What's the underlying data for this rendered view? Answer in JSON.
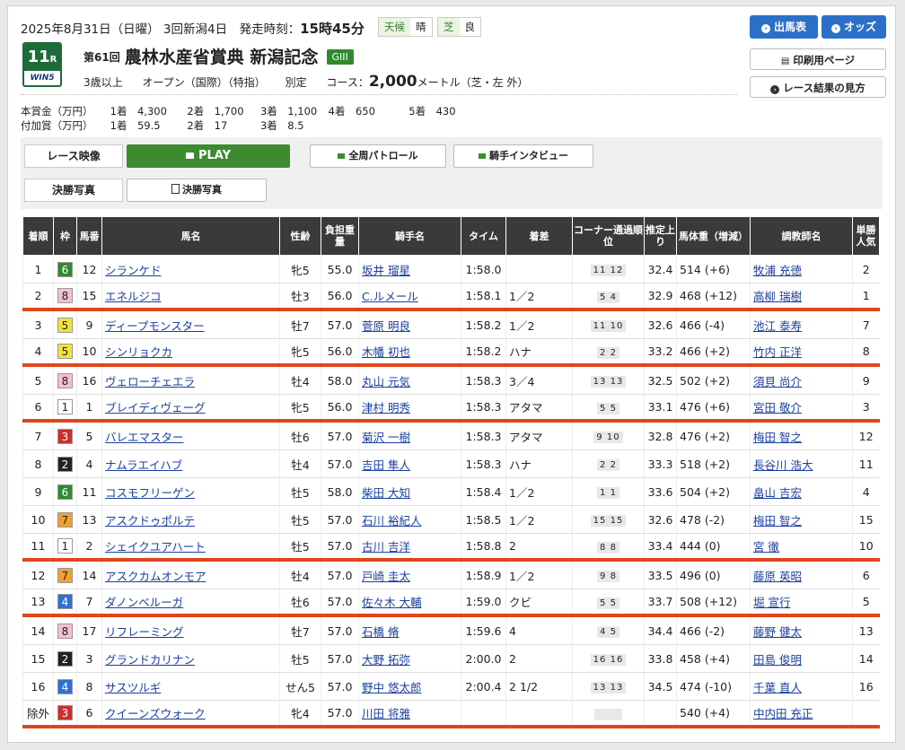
{
  "header": {
    "date_line": "2025年8月31日（日曜） 3回新潟4日　発走時刻：",
    "post_time": "15時45分",
    "weather_key": "天候",
    "weather_val": "晴",
    "turf_key": "芝",
    "turf_val": "良",
    "race_num": "11",
    "race_num_suffix": "R",
    "win5_label": "WIN5",
    "ordinal": "第61回",
    "race_name": "農林水産省賞典 新潟記念",
    "grade": "GIII",
    "age": "3歳以上",
    "class": "オープン（国際）（特指）",
    "weight_rule": "別定",
    "course_label": "コース：",
    "distance": "2,000",
    "course_detail": "メートル（芝・左 外）"
  },
  "prize_main": {
    "label": "本賞金（万円）",
    "items": [
      "1着　4,300",
      "2着　1,700",
      "3着　1,100",
      "4着　650",
      "5着　430"
    ]
  },
  "prize_add": {
    "label": "付加賞（万円）",
    "items": [
      "1着　59.5",
      "2着　17",
      "3着　8.5"
    ]
  },
  "buttons": {
    "card": "出馬表",
    "odds": "オッズ",
    "print": "印刷用ページ",
    "howto": "レース結果の見方"
  },
  "video": {
    "label": "レース映像",
    "play": "PLAY",
    "patrol": "全周パトロール",
    "interview": "騎手インタビュー"
  },
  "photo": {
    "label": "決勝写真",
    "button": "決勝写真"
  },
  "table_headers": [
    "着順",
    "枠",
    "馬番",
    "馬名",
    "性齢",
    "負担重量",
    "騎手名",
    "タイム",
    "着差",
    "コーナー通過順位",
    "推定上り",
    "馬体重（増減）",
    "調教師名",
    "単勝人気"
  ],
  "colors": {
    "accent_red": "#e0451b",
    "play_green": "#3d8b2e",
    "button_blue": "#2c6fc9"
  },
  "rows": [
    {
      "pos": "1",
      "waku": "6",
      "num": "12",
      "name": "シランケド",
      "sex": "牝5",
      "wt": "55.0",
      "jockey": "坂井 瑠星",
      "time": "1:58.0",
      "margin": "",
      "corner": "11 12",
      "last": "32.4",
      "body": "514 (+6)",
      "trainer": "牧浦 充徳",
      "pop": "2",
      "hl": false
    },
    {
      "pos": "2",
      "waku": "8",
      "num": "15",
      "name": "エネルジコ",
      "sex": "牡3",
      "wt": "56.0",
      "jockey": "C.ルメール",
      "time": "1:58.1",
      "margin": "1／2",
      "corner": "5 4",
      "last": "32.9",
      "body": "468 (+12)",
      "trainer": "高柳 瑞樹",
      "pop": "1",
      "hl": true
    },
    {
      "pos": "3",
      "waku": "5",
      "num": "9",
      "name": "ディープモンスター",
      "sex": "牡7",
      "wt": "57.0",
      "jockey": "菅原 明良",
      "time": "1:58.2",
      "margin": "1／2",
      "corner": "11 10",
      "last": "32.6",
      "body": "466 (-4)",
      "trainer": "池江 泰寿",
      "pop": "7",
      "hl": false
    },
    {
      "pos": "4",
      "waku": "5",
      "num": "10",
      "name": "シンリョクカ",
      "sex": "牝5",
      "wt": "56.0",
      "jockey": "木幡 初也",
      "time": "1:58.2",
      "margin": "ハナ",
      "corner": "2 2",
      "last": "33.2",
      "body": "466 (+2)",
      "trainer": "竹内 正洋",
      "pop": "8",
      "hl": true
    },
    {
      "pos": "5",
      "waku": "8",
      "num": "16",
      "name": "ヴェローチェエラ",
      "sex": "牡4",
      "wt": "58.0",
      "jockey": "丸山 元気",
      "time": "1:58.3",
      "margin": "3／4",
      "corner": "13 13",
      "last": "32.5",
      "body": "502 (+2)",
      "trainer": "須貝 尚介",
      "pop": "9",
      "hl": false
    },
    {
      "pos": "6",
      "waku": "1",
      "num": "1",
      "name": "ブレイディヴェーグ",
      "sex": "牝5",
      "wt": "56.0",
      "jockey": "津村 明秀",
      "time": "1:58.3",
      "margin": "アタマ",
      "corner": "5 5",
      "last": "33.1",
      "body": "476 (+6)",
      "trainer": "宮田 敬介",
      "pop": "3",
      "hl": true
    },
    {
      "pos": "7",
      "waku": "3",
      "num": "5",
      "name": "バレエマスター",
      "sex": "牡6",
      "wt": "57.0",
      "jockey": "菊沢 一樹",
      "time": "1:58.3",
      "margin": "アタマ",
      "corner": "9 10",
      "last": "32.8",
      "body": "476 (+2)",
      "trainer": "梅田 智之",
      "pop": "12",
      "hl": false
    },
    {
      "pos": "8",
      "waku": "2",
      "num": "4",
      "name": "ナムラエイハブ",
      "sex": "牡4",
      "wt": "57.0",
      "jockey": "吉田 隼人",
      "time": "1:58.3",
      "margin": "ハナ",
      "corner": "2 2",
      "last": "33.3",
      "body": "518 (+2)",
      "trainer": "長谷川 浩大",
      "pop": "11",
      "hl": false
    },
    {
      "pos": "9",
      "waku": "6",
      "num": "11",
      "name": "コスモフリーゲン",
      "sex": "牡5",
      "wt": "58.0",
      "jockey": "柴田 大知",
      "time": "1:58.4",
      "margin": "1／2",
      "corner": "1 1",
      "last": "33.6",
      "body": "504 (+2)",
      "trainer": "畠山 吉宏",
      "pop": "4",
      "hl": false
    },
    {
      "pos": "10",
      "waku": "7",
      "num": "13",
      "name": "アスクドゥポルテ",
      "sex": "牡5",
      "wt": "57.0",
      "jockey": "石川 裕紀人",
      "time": "1:58.5",
      "margin": "1／2",
      "corner": "15 15",
      "last": "32.6",
      "body": "478 (-2)",
      "trainer": "梅田 智之",
      "pop": "15",
      "hl": false
    },
    {
      "pos": "11",
      "waku": "1",
      "num": "2",
      "name": "シェイクユアハート",
      "sex": "牡5",
      "wt": "57.0",
      "jockey": "古川 吉洋",
      "time": "1:58.8",
      "margin": "2",
      "corner": "8 8",
      "last": "33.4",
      "body": "444 (0)",
      "trainer": "宮 徹",
      "pop": "10",
      "hl": true
    },
    {
      "pos": "12",
      "waku": "7",
      "num": "14",
      "name": "アスクカムオンモア",
      "sex": "牡4",
      "wt": "57.0",
      "jockey": "戸崎 圭太",
      "time": "1:58.9",
      "margin": "1／2",
      "corner": "9 8",
      "last": "33.5",
      "body": "496 (0)",
      "trainer": "藤原 英昭",
      "pop": "6",
      "hl": false
    },
    {
      "pos": "13",
      "waku": "4",
      "num": "7",
      "name": "ダノンベルーガ",
      "sex": "牡6",
      "wt": "57.0",
      "jockey": "佐々木 大輔",
      "time": "1:59.0",
      "margin": "クビ",
      "corner": "5 5",
      "last": "33.7",
      "body": "508 (+12)",
      "trainer": "堀 宣行",
      "pop": "5",
      "hl": true
    },
    {
      "pos": "14",
      "waku": "8",
      "num": "17",
      "name": "リフレーミング",
      "sex": "牡7",
      "wt": "57.0",
      "jockey": "石橋 脩",
      "time": "1:59.6",
      "margin": "4",
      "corner": "4 5",
      "last": "34.4",
      "body": "466 (-2)",
      "trainer": "藤野 健太",
      "pop": "13",
      "hl": false
    },
    {
      "pos": "15",
      "waku": "2",
      "num": "3",
      "name": "グランドカリナン",
      "sex": "牡5",
      "wt": "57.0",
      "jockey": "大野 拓弥",
      "time": "2:00.0",
      "margin": "2",
      "corner": "16 16",
      "last": "33.8",
      "body": "458 (+4)",
      "trainer": "田島 俊明",
      "pop": "14",
      "hl": false
    },
    {
      "pos": "16",
      "waku": "4",
      "num": "8",
      "name": "サスツルギ",
      "sex": "せん5",
      "wt": "57.0",
      "jockey": "野中 悠太郎",
      "time": "2:00.4",
      "margin": "2 1/2",
      "corner": "13 13",
      "last": "34.5",
      "body": "474 (-10)",
      "trainer": "千葉 直人",
      "pop": "16",
      "hl": false
    },
    {
      "pos": "除外",
      "waku": "3",
      "num": "6",
      "name": "クイーンズウォーク",
      "sex": "牝4",
      "wt": "57.0",
      "jockey": "川田 将雅",
      "time": "",
      "margin": "",
      "corner": "",
      "last": "",
      "body": "540 (+4)",
      "trainer": "中内田 充正",
      "pop": "",
      "hl": true
    }
  ]
}
